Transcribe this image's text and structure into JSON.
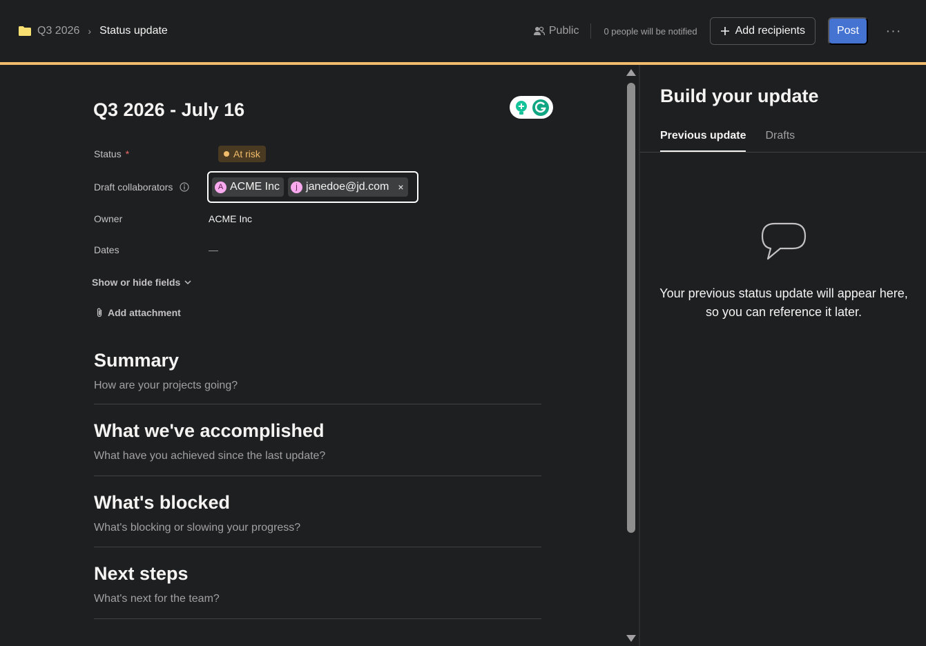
{
  "breadcrumb": {
    "parent": "Q3 2026",
    "separator": "›",
    "current": "Status update"
  },
  "header": {
    "visibility": "Public",
    "notify_text": "0 people will be notified",
    "add_recipients": "Add recipients",
    "post": "Post",
    "more": "···"
  },
  "colors": {
    "accent_bar": "#f1bd6c",
    "post_button": "#4573d2",
    "status_at_risk": "#f1bd6c"
  },
  "editor": {
    "title": "Q3 2026 - July 16",
    "fields": {
      "status_label": "Status",
      "status_required": "*",
      "status_value": "At risk",
      "collaborators_label": "Draft collaborators",
      "collaborators": [
        {
          "initial": "A",
          "name": "ACME Inc"
        },
        {
          "initial": "j",
          "name": "janedoe@jd.com"
        }
      ],
      "collaborator_remove": "×",
      "owner_label": "Owner",
      "owner_value": "ACME Inc",
      "dates_label": "Dates",
      "dates_value": "—"
    },
    "show_hide_fields": "Show or hide fields",
    "add_attachment": "Add attachment",
    "sections": [
      {
        "title": "Summary",
        "placeholder": "How are your projects going?"
      },
      {
        "title": "What we've accomplished",
        "placeholder": "What have you achieved since the last update?"
      },
      {
        "title": "What's blocked",
        "placeholder": "What's blocking or slowing your progress?"
      },
      {
        "title": "Next steps",
        "placeholder": "What's next for the team?"
      }
    ]
  },
  "side_panel": {
    "title": "Build your update",
    "tabs": [
      "Previous update",
      "Drafts"
    ],
    "empty_text": "Your previous status update will appear here, so you can reference it later."
  }
}
